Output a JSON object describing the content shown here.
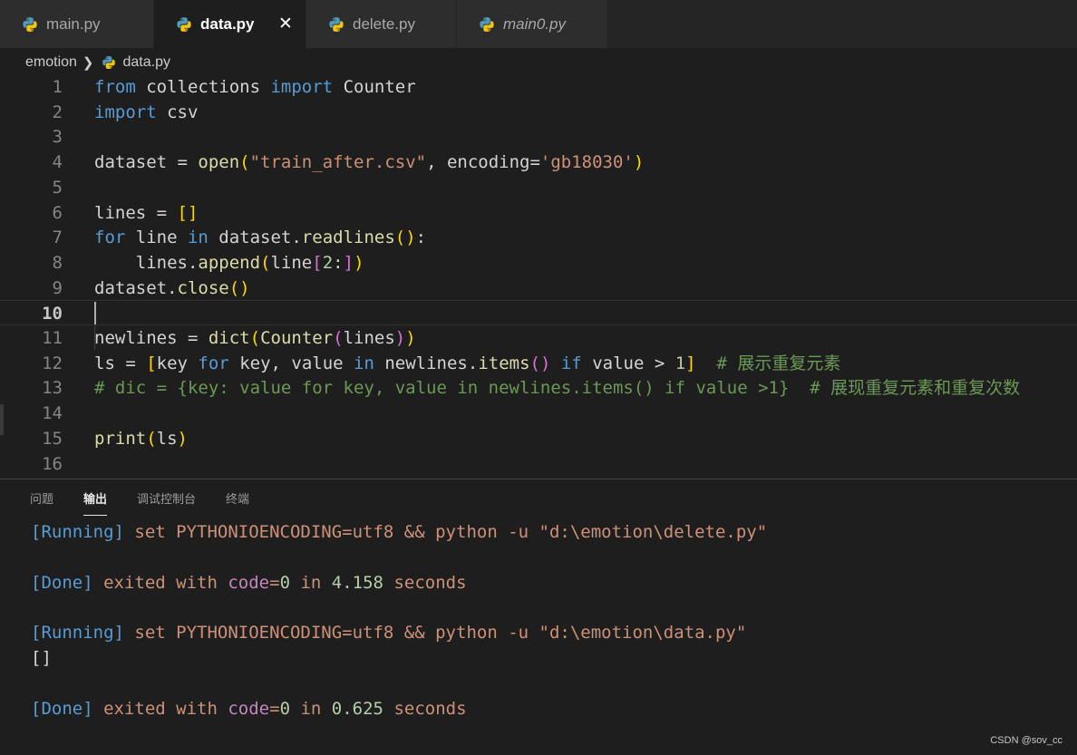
{
  "tabs": [
    {
      "label": "main.py",
      "active": false,
      "italic": false
    },
    {
      "label": "data.py",
      "active": true,
      "italic": false,
      "close": "✕"
    },
    {
      "label": "delete.py",
      "active": false,
      "italic": false
    },
    {
      "label": "main0.py",
      "active": false,
      "italic": true
    }
  ],
  "breadcrumb": {
    "folder": "emotion",
    "separator": "❯",
    "file": "data.py"
  },
  "editor": {
    "current_line": 10,
    "lines": [
      {
        "n": "1",
        "parts": [
          [
            "kw",
            "from"
          ],
          [
            "t",
            " collections "
          ],
          [
            "kw",
            "import"
          ],
          [
            "t",
            " Counter"
          ]
        ]
      },
      {
        "n": "2",
        "parts": [
          [
            "kw",
            "import"
          ],
          [
            "t",
            " csv"
          ]
        ]
      },
      {
        "n": "3",
        "parts": []
      },
      {
        "n": "4",
        "parts": [
          [
            "t",
            "dataset = "
          ],
          [
            "fn",
            "open"
          ],
          [
            "b1",
            "("
          ],
          [
            "str",
            "\"train_after.csv\""
          ],
          [
            "t",
            ", encoding="
          ],
          [
            "str",
            "'gb18030'"
          ],
          [
            "b1",
            ")"
          ]
        ]
      },
      {
        "n": "5",
        "parts": []
      },
      {
        "n": "6",
        "parts": [
          [
            "t",
            "lines = "
          ],
          [
            "b1",
            "[]"
          ]
        ]
      },
      {
        "n": "7",
        "parts": [
          [
            "ctl",
            "for"
          ],
          [
            "t",
            " line "
          ],
          [
            "ctl",
            "in"
          ],
          [
            "t",
            " dataset."
          ],
          [
            "fn",
            "readlines"
          ],
          [
            "b1",
            "()"
          ],
          [
            "t",
            ":"
          ]
        ]
      },
      {
        "n": "8",
        "parts": [
          [
            "t",
            "    lines."
          ],
          [
            "fn",
            "append"
          ],
          [
            "b1",
            "("
          ],
          [
            "t",
            "line"
          ],
          [
            "b2",
            "["
          ],
          [
            "num",
            "2"
          ],
          [
            "t",
            ":"
          ],
          [
            "b2",
            "]"
          ],
          [
            "b1",
            ")"
          ]
        ]
      },
      {
        "n": "9",
        "parts": [
          [
            "t",
            "dataset."
          ],
          [
            "fn",
            "close"
          ],
          [
            "b1",
            "()"
          ]
        ]
      },
      {
        "n": "10",
        "parts": []
      },
      {
        "n": "11",
        "parts": [
          [
            "t",
            "newlines = "
          ],
          [
            "fn",
            "dict"
          ],
          [
            "b1",
            "("
          ],
          [
            "fn",
            "Counter"
          ],
          [
            "b2",
            "("
          ],
          [
            "t",
            "lines"
          ],
          [
            "b2",
            ")"
          ],
          [
            "b1",
            ")"
          ]
        ]
      },
      {
        "n": "12",
        "parts": [
          [
            "t",
            "ls = "
          ],
          [
            "b1",
            "["
          ],
          [
            "t",
            "key "
          ],
          [
            "ctl",
            "for"
          ],
          [
            "t",
            " key, value "
          ],
          [
            "ctl",
            "in"
          ],
          [
            "t",
            " newlines."
          ],
          [
            "fn",
            "items"
          ],
          [
            "b2",
            "()"
          ],
          [
            "t",
            " "
          ],
          [
            "ctl",
            "if"
          ],
          [
            "t",
            " value > "
          ],
          [
            "num",
            "1"
          ],
          [
            "b1",
            "]"
          ],
          [
            "t",
            "  "
          ],
          [
            "cmt",
            "# 展示重复元素"
          ]
        ]
      },
      {
        "n": "13",
        "parts": [
          [
            "cmt",
            "# dic = {key: value for key, value in newlines.items() if value >1}  # 展现重复元素和重复次数"
          ]
        ]
      },
      {
        "n": "14",
        "parts": []
      },
      {
        "n": "15",
        "parts": [
          [
            "fn",
            "print"
          ],
          [
            "b1",
            "("
          ],
          [
            "t",
            "ls"
          ],
          [
            "b1",
            ")"
          ]
        ]
      },
      {
        "n": "16",
        "parts": []
      }
    ]
  },
  "panel": {
    "tabs": [
      {
        "label": "问题",
        "active": false
      },
      {
        "label": "输出",
        "active": true
      },
      {
        "label": "调试控制台",
        "active": false
      },
      {
        "label": "终端",
        "active": false
      }
    ],
    "output": [
      {
        "row": 0,
        "parts": [
          [
            "o-tag",
            "[Running]"
          ],
          [
            "o-cmd",
            " set PYTHONIOENCODING=utf8 && python -u \"d:\\emotion\\delete.py\""
          ]
        ]
      },
      {
        "row": 2,
        "parts": [
          [
            "o-tag",
            "[Done]"
          ],
          [
            "o-cmd",
            " exited with "
          ],
          [
            "o-kw",
            "code"
          ],
          [
            "o-cmd",
            "="
          ],
          [
            "o-num",
            "0"
          ],
          [
            "o-cmd",
            " in "
          ],
          [
            "o-num",
            "4.158"
          ],
          [
            "o-cmd",
            " seconds"
          ]
        ]
      },
      {
        "row": 4,
        "parts": [
          [
            "o-tag",
            "[Running]"
          ],
          [
            "o-cmd",
            " set PYTHONIOENCODING=utf8 && python -u \"d:\\emotion\\data.py\""
          ]
        ]
      },
      {
        "row": 5,
        "parts": [
          [
            "o-text",
            "[]"
          ]
        ]
      },
      {
        "row": 7,
        "parts": [
          [
            "o-tag",
            "[Done]"
          ],
          [
            "o-cmd",
            " exited with "
          ],
          [
            "o-kw",
            "code"
          ],
          [
            "o-cmd",
            "="
          ],
          [
            "o-num",
            "0"
          ],
          [
            "o-cmd",
            " in "
          ],
          [
            "o-num",
            "0.625"
          ],
          [
            "o-cmd",
            " seconds"
          ]
        ]
      }
    ]
  },
  "watermark": "CSDN @sov_cc",
  "colors": {
    "python_icon_blue": "#519aba",
    "python_icon_yellow": "#f1c40f",
    "background": "#1e1e1e"
  }
}
